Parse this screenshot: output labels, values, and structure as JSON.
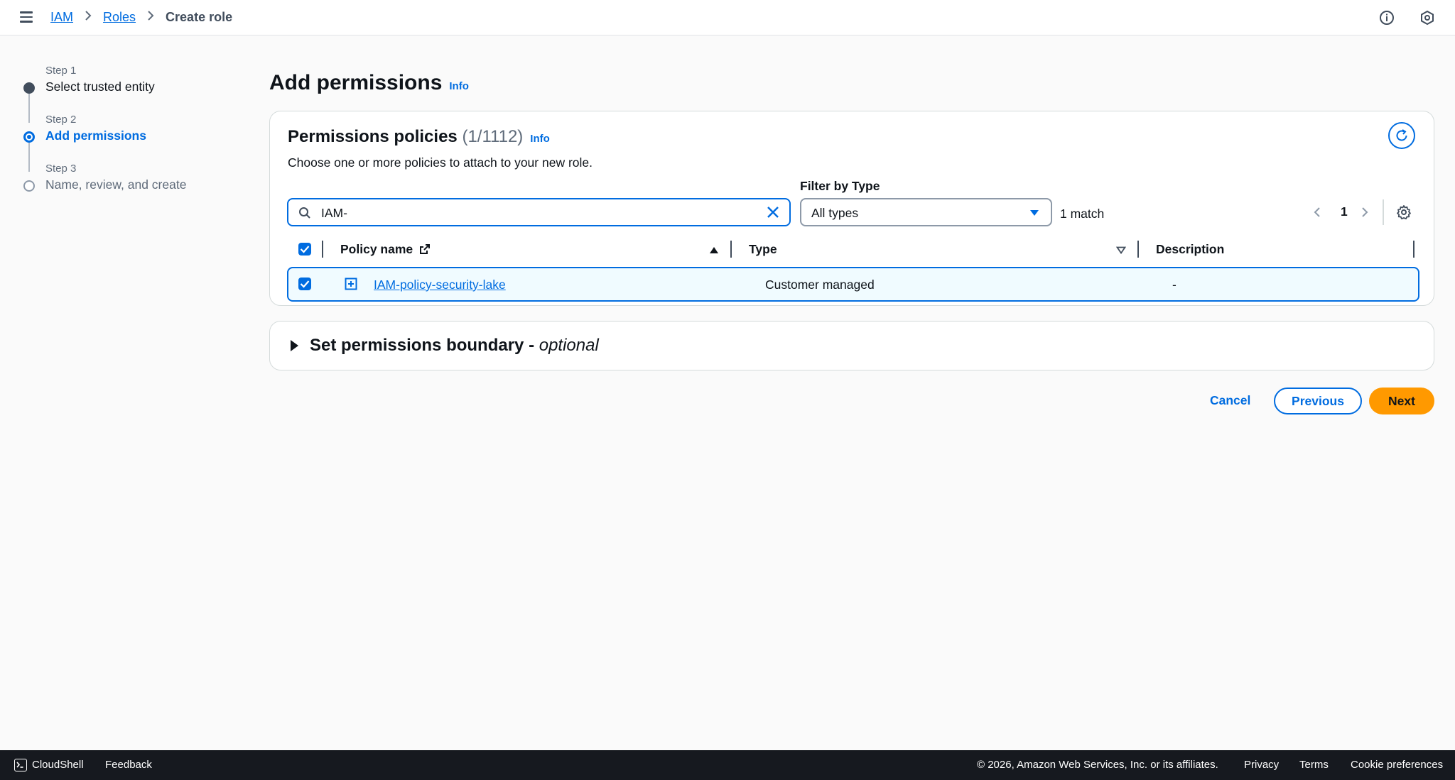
{
  "breadcrumb": {
    "items": [
      "IAM",
      "Roles"
    ],
    "current": "Create role"
  },
  "steps": [
    {
      "label": "Step 1",
      "title": "Select trusted entity"
    },
    {
      "label": "Step 2",
      "title": "Add permissions"
    },
    {
      "label": "Step 3",
      "title": "Name, review, and create"
    }
  ],
  "page": {
    "title": "Add permissions",
    "info": "Info"
  },
  "policies": {
    "title": "Permissions policies",
    "count": "(1/1112)",
    "info": "Info",
    "description": "Choose one or more policies to attach to your new role.",
    "search_value": "IAM-",
    "filter_label": "Filter by Type",
    "filter_value": "All types",
    "match_count": "1 match",
    "page_number": "1",
    "columns": [
      "Policy name",
      "Type",
      "Description"
    ],
    "rows": [
      {
        "name": "IAM-policy-security-lake",
        "type": "Customer managed",
        "description": "-"
      }
    ]
  },
  "boundary": {
    "title": "Set permissions boundary - ",
    "optional": "optional"
  },
  "actions": {
    "cancel": "Cancel",
    "previous": "Previous",
    "next": "Next"
  },
  "footer": {
    "cloudshell": "CloudShell",
    "feedback": "Feedback",
    "copyright": "© 2026, Amazon Web Services, Inc. or its affiliates.",
    "privacy": "Privacy",
    "terms": "Terms",
    "cookies": "Cookie preferences"
  },
  "colors": {
    "accent": "#006ce0",
    "primary_button": "#ff9900",
    "footer_bg": "#16191f"
  }
}
